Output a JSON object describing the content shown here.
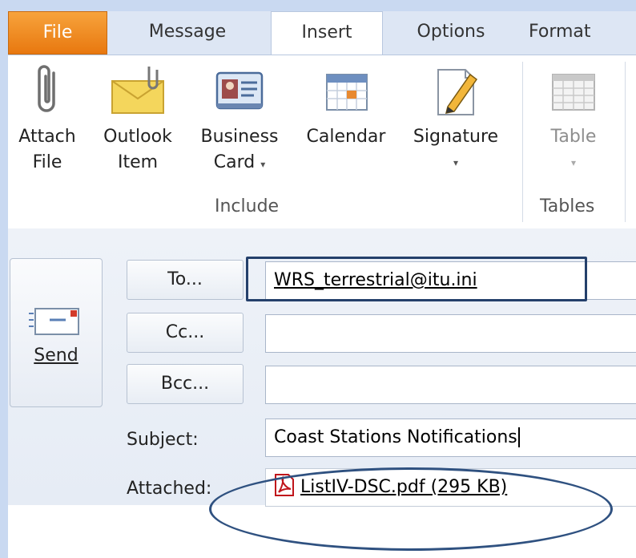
{
  "tabs": {
    "file": "File",
    "message": "Message",
    "insert": "Insert",
    "options": "Options",
    "format": "Format"
  },
  "ribbon": {
    "attach_file": {
      "line1": "Attach",
      "line2": "File",
      "icon": "paperclip-icon"
    },
    "outlook_item": {
      "line1": "Outlook",
      "line2": "Item",
      "icon": "envelope-icon"
    },
    "business_card": {
      "line1": "Business",
      "line2": "Card",
      "icon": "business-card-icon"
    },
    "calendar": {
      "line1": "Calendar",
      "icon": "calendar-icon"
    },
    "signature": {
      "line1": "Signature",
      "icon": "signature-icon"
    },
    "table": {
      "line1": "Table",
      "icon": "table-icon"
    },
    "groups": {
      "include": "Include",
      "tables": "Tables"
    },
    "dropdown_glyph": "▾"
  },
  "compose": {
    "send_label": "Send",
    "to_button": "To...",
    "cc_button": "Cc...",
    "bcc_button": "Bcc...",
    "to_value": "WRS_terrestrial@itu.ini",
    "cc_value": "",
    "bcc_value": "",
    "subject_label": "Subject:",
    "subject_value": "Coast Stations Notifications",
    "attached_label": "Attached:",
    "attachment": "ListIV-DSC.pdf (295 KB)"
  },
  "colors": {
    "file_tab": "#e8780f",
    "highlight_box": "#24406b",
    "annotation_ellipse": "#2f5180",
    "pdf_red": "#c0151b"
  }
}
